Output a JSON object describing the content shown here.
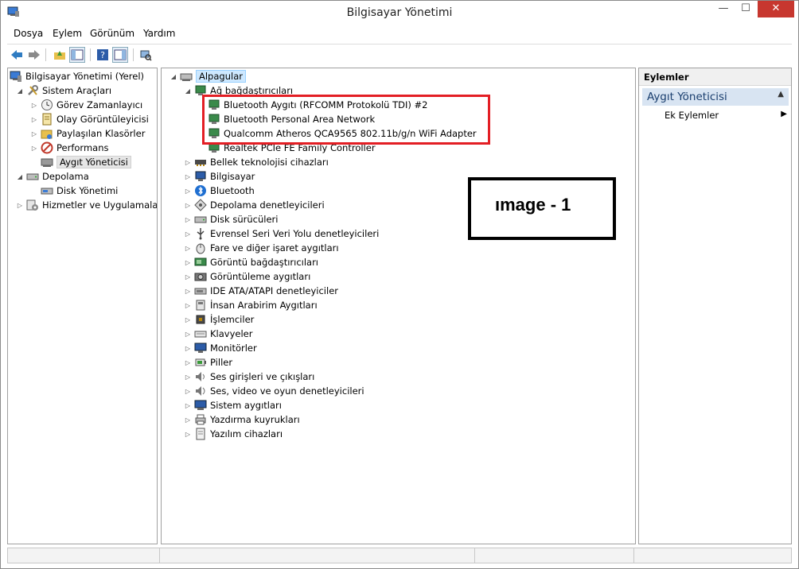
{
  "window": {
    "title": "Bilgisayar Yönetimi"
  },
  "menubar": [
    "Dosya",
    "Eylem",
    "Görünüm",
    "Yardım"
  ],
  "left_tree": [
    {
      "label": "Bilgisayar Yönetimi (Yerel)",
      "icon": "computer-management-icon",
      "arrow": "",
      "level": 0
    },
    {
      "label": "Sistem Araçları",
      "icon": "tools-icon",
      "arrow": "open",
      "level": 1
    },
    {
      "label": "Görev Zamanlayıcı",
      "icon": "clock-icon",
      "arrow": "closed",
      "level": 2
    },
    {
      "label": "Olay Görüntüleyicisi",
      "icon": "event-viewer-icon",
      "arrow": "closed",
      "level": 2
    },
    {
      "label": "Paylaşılan Klasörler",
      "icon": "shared-folder-icon",
      "arrow": "closed",
      "level": 2
    },
    {
      "label": "Performans",
      "icon": "performance-icon",
      "arrow": "closed",
      "level": 2
    },
    {
      "label": "Aygıt Yöneticisi",
      "icon": "device-manager-icon",
      "arrow": "",
      "level": 2,
      "selected": true
    },
    {
      "label": "Depolama",
      "icon": "storage-icon",
      "arrow": "open",
      "level": 1
    },
    {
      "label": "Disk Yönetimi",
      "icon": "disk-management-icon",
      "arrow": "",
      "level": 2
    },
    {
      "label": "Hizmetler ve Uygulamalar",
      "icon": "services-icon",
      "arrow": "closed",
      "level": 1
    }
  ],
  "device_tree": {
    "root": "Alpagular",
    "network_category": "Ağ bağdaştırıcıları",
    "network_adapters": [
      "Bluetooth Aygıtı (RFCOMM Protokolü TDI) #2",
      "Bluetooth Personal Area Network",
      "Qualcomm Atheros QCA9565 802.11b/g/n WiFi Adapter",
      "Realtek PCIe FE Family Controller"
    ],
    "categories": [
      {
        "label": "Bellek teknolojisi cihazları",
        "icon": "memory-icon"
      },
      {
        "label": "Bilgisayar",
        "icon": "computer-icon"
      },
      {
        "label": "Bluetooth",
        "icon": "bluetooth-icon"
      },
      {
        "label": "Depolama denetleyicileri",
        "icon": "storage-controller-icon"
      },
      {
        "label": "Disk sürücüleri",
        "icon": "disk-drive-icon"
      },
      {
        "label": "Evrensel Seri Veri Yolu denetleyicileri",
        "icon": "usb-icon"
      },
      {
        "label": "Fare ve diğer işaret aygıtları",
        "icon": "mouse-icon"
      },
      {
        "label": "Görüntü bağdaştırıcıları",
        "icon": "display-adapter-icon"
      },
      {
        "label": "Görüntüleme aygıtları",
        "icon": "imaging-device-icon"
      },
      {
        "label": "IDE ATA/ATAPI denetleyiciler",
        "icon": "ide-icon"
      },
      {
        "label": "İnsan Arabirim Aygıtları",
        "icon": "hid-icon"
      },
      {
        "label": "İşlemciler",
        "icon": "processor-icon"
      },
      {
        "label": "Klavyeler",
        "icon": "keyboard-icon"
      },
      {
        "label": "Monitörler",
        "icon": "monitor-icon"
      },
      {
        "label": "Piller",
        "icon": "battery-icon"
      },
      {
        "label": "Ses girişleri ve çıkışları",
        "icon": "audio-io-icon"
      },
      {
        "label": "Ses, video ve oyun denetleyicileri",
        "icon": "sound-icon"
      },
      {
        "label": "Sistem aygıtları",
        "icon": "system-device-icon"
      },
      {
        "label": "Yazdırma kuyrukları",
        "icon": "printer-icon"
      },
      {
        "label": "Yazılım cihazları",
        "icon": "software-device-icon"
      }
    ]
  },
  "annotation": {
    "text": "ımage - 1"
  },
  "actions": {
    "header": "Eylemler",
    "section": "Aygıt Yöneticisi",
    "item": "Ek Eylemler"
  },
  "colors": {
    "highlight_box": "#e31e24",
    "selection": "#cde8ff",
    "actions_section": "#d8e4f2"
  }
}
